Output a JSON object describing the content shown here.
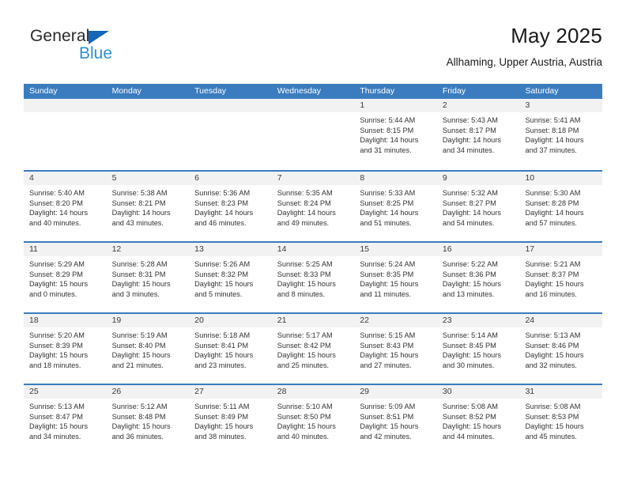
{
  "logo": {
    "primary_text": "General",
    "secondary_text": "Blue",
    "triangle_icon": "triangle-icon",
    "primary_color": "#2b2b2b",
    "secondary_color": "#2a8fd8",
    "triangle_color": "#1565b8"
  },
  "header": {
    "title": "May 2025",
    "subtitle": "Allhaming, Upper Austria, Austria"
  },
  "theme": {
    "header_bg": "#3a7cbf",
    "header_text": "#ffffff",
    "daynum_band_bg": "#f2f2f2",
    "cell_bg": "#ffffff",
    "body_text": "#333333"
  },
  "calendar": {
    "weekdays": [
      "Sunday",
      "Monday",
      "Tuesday",
      "Wednesday",
      "Thursday",
      "Friday",
      "Saturday"
    ],
    "weeks": [
      [
        {
          "day": "",
          "empty": true,
          "sunrise": "",
          "sunset": "",
          "daylight_line1": "",
          "daylight_line2": ""
        },
        {
          "day": "",
          "empty": true,
          "sunrise": "",
          "sunset": "",
          "daylight_line1": "",
          "daylight_line2": ""
        },
        {
          "day": "",
          "empty": true,
          "sunrise": "",
          "sunset": "",
          "daylight_line1": "",
          "daylight_line2": ""
        },
        {
          "day": "",
          "empty": true,
          "sunrise": "",
          "sunset": "",
          "daylight_line1": "",
          "daylight_line2": ""
        },
        {
          "day": "1",
          "empty": false,
          "sunrise": "Sunrise: 5:44 AM",
          "sunset": "Sunset: 8:15 PM",
          "daylight_line1": "Daylight: 14 hours",
          "daylight_line2": "and 31 minutes."
        },
        {
          "day": "2",
          "empty": false,
          "sunrise": "Sunrise: 5:43 AM",
          "sunset": "Sunset: 8:17 PM",
          "daylight_line1": "Daylight: 14 hours",
          "daylight_line2": "and 34 minutes."
        },
        {
          "day": "3",
          "empty": false,
          "sunrise": "Sunrise: 5:41 AM",
          "sunset": "Sunset: 8:18 PM",
          "daylight_line1": "Daylight: 14 hours",
          "daylight_line2": "and 37 minutes."
        }
      ],
      [
        {
          "day": "4",
          "empty": false,
          "sunrise": "Sunrise: 5:40 AM",
          "sunset": "Sunset: 8:20 PM",
          "daylight_line1": "Daylight: 14 hours",
          "daylight_line2": "and 40 minutes."
        },
        {
          "day": "5",
          "empty": false,
          "sunrise": "Sunrise: 5:38 AM",
          "sunset": "Sunset: 8:21 PM",
          "daylight_line1": "Daylight: 14 hours",
          "daylight_line2": "and 43 minutes."
        },
        {
          "day": "6",
          "empty": false,
          "sunrise": "Sunrise: 5:36 AM",
          "sunset": "Sunset: 8:23 PM",
          "daylight_line1": "Daylight: 14 hours",
          "daylight_line2": "and 46 minutes."
        },
        {
          "day": "7",
          "empty": false,
          "sunrise": "Sunrise: 5:35 AM",
          "sunset": "Sunset: 8:24 PM",
          "daylight_line1": "Daylight: 14 hours",
          "daylight_line2": "and 49 minutes."
        },
        {
          "day": "8",
          "empty": false,
          "sunrise": "Sunrise: 5:33 AM",
          "sunset": "Sunset: 8:25 PM",
          "daylight_line1": "Daylight: 14 hours",
          "daylight_line2": "and 51 minutes."
        },
        {
          "day": "9",
          "empty": false,
          "sunrise": "Sunrise: 5:32 AM",
          "sunset": "Sunset: 8:27 PM",
          "daylight_line1": "Daylight: 14 hours",
          "daylight_line2": "and 54 minutes."
        },
        {
          "day": "10",
          "empty": false,
          "sunrise": "Sunrise: 5:30 AM",
          "sunset": "Sunset: 8:28 PM",
          "daylight_line1": "Daylight: 14 hours",
          "daylight_line2": "and 57 minutes."
        }
      ],
      [
        {
          "day": "11",
          "empty": false,
          "sunrise": "Sunrise: 5:29 AM",
          "sunset": "Sunset: 8:29 PM",
          "daylight_line1": "Daylight: 15 hours",
          "daylight_line2": "and 0 minutes."
        },
        {
          "day": "12",
          "empty": false,
          "sunrise": "Sunrise: 5:28 AM",
          "sunset": "Sunset: 8:31 PM",
          "daylight_line1": "Daylight: 15 hours",
          "daylight_line2": "and 3 minutes."
        },
        {
          "day": "13",
          "empty": false,
          "sunrise": "Sunrise: 5:26 AM",
          "sunset": "Sunset: 8:32 PM",
          "daylight_line1": "Daylight: 15 hours",
          "daylight_line2": "and 5 minutes."
        },
        {
          "day": "14",
          "empty": false,
          "sunrise": "Sunrise: 5:25 AM",
          "sunset": "Sunset: 8:33 PM",
          "daylight_line1": "Daylight: 15 hours",
          "daylight_line2": "and 8 minutes."
        },
        {
          "day": "15",
          "empty": false,
          "sunrise": "Sunrise: 5:24 AM",
          "sunset": "Sunset: 8:35 PM",
          "daylight_line1": "Daylight: 15 hours",
          "daylight_line2": "and 11 minutes."
        },
        {
          "day": "16",
          "empty": false,
          "sunrise": "Sunrise: 5:22 AM",
          "sunset": "Sunset: 8:36 PM",
          "daylight_line1": "Daylight: 15 hours",
          "daylight_line2": "and 13 minutes."
        },
        {
          "day": "17",
          "empty": false,
          "sunrise": "Sunrise: 5:21 AM",
          "sunset": "Sunset: 8:37 PM",
          "daylight_line1": "Daylight: 15 hours",
          "daylight_line2": "and 16 minutes."
        }
      ],
      [
        {
          "day": "18",
          "empty": false,
          "sunrise": "Sunrise: 5:20 AM",
          "sunset": "Sunset: 8:39 PM",
          "daylight_line1": "Daylight: 15 hours",
          "daylight_line2": "and 18 minutes."
        },
        {
          "day": "19",
          "empty": false,
          "sunrise": "Sunrise: 5:19 AM",
          "sunset": "Sunset: 8:40 PM",
          "daylight_line1": "Daylight: 15 hours",
          "daylight_line2": "and 21 minutes."
        },
        {
          "day": "20",
          "empty": false,
          "sunrise": "Sunrise: 5:18 AM",
          "sunset": "Sunset: 8:41 PM",
          "daylight_line1": "Daylight: 15 hours",
          "daylight_line2": "and 23 minutes."
        },
        {
          "day": "21",
          "empty": false,
          "sunrise": "Sunrise: 5:17 AM",
          "sunset": "Sunset: 8:42 PM",
          "daylight_line1": "Daylight: 15 hours",
          "daylight_line2": "and 25 minutes."
        },
        {
          "day": "22",
          "empty": false,
          "sunrise": "Sunrise: 5:15 AM",
          "sunset": "Sunset: 8:43 PM",
          "daylight_line1": "Daylight: 15 hours",
          "daylight_line2": "and 27 minutes."
        },
        {
          "day": "23",
          "empty": false,
          "sunrise": "Sunrise: 5:14 AM",
          "sunset": "Sunset: 8:45 PM",
          "daylight_line1": "Daylight: 15 hours",
          "daylight_line2": "and 30 minutes."
        },
        {
          "day": "24",
          "empty": false,
          "sunrise": "Sunrise: 5:13 AM",
          "sunset": "Sunset: 8:46 PM",
          "daylight_line1": "Daylight: 15 hours",
          "daylight_line2": "and 32 minutes."
        }
      ],
      [
        {
          "day": "25",
          "empty": false,
          "sunrise": "Sunrise: 5:13 AM",
          "sunset": "Sunset: 8:47 PM",
          "daylight_line1": "Daylight: 15 hours",
          "daylight_line2": "and 34 minutes."
        },
        {
          "day": "26",
          "empty": false,
          "sunrise": "Sunrise: 5:12 AM",
          "sunset": "Sunset: 8:48 PM",
          "daylight_line1": "Daylight: 15 hours",
          "daylight_line2": "and 36 minutes."
        },
        {
          "day": "27",
          "empty": false,
          "sunrise": "Sunrise: 5:11 AM",
          "sunset": "Sunset: 8:49 PM",
          "daylight_line1": "Daylight: 15 hours",
          "daylight_line2": "and 38 minutes."
        },
        {
          "day": "28",
          "empty": false,
          "sunrise": "Sunrise: 5:10 AM",
          "sunset": "Sunset: 8:50 PM",
          "daylight_line1": "Daylight: 15 hours",
          "daylight_line2": "and 40 minutes."
        },
        {
          "day": "29",
          "empty": false,
          "sunrise": "Sunrise: 5:09 AM",
          "sunset": "Sunset: 8:51 PM",
          "daylight_line1": "Daylight: 15 hours",
          "daylight_line2": "and 42 minutes."
        },
        {
          "day": "30",
          "empty": false,
          "sunrise": "Sunrise: 5:08 AM",
          "sunset": "Sunset: 8:52 PM",
          "daylight_line1": "Daylight: 15 hours",
          "daylight_line2": "and 44 minutes."
        },
        {
          "day": "31",
          "empty": false,
          "sunrise": "Sunrise: 5:08 AM",
          "sunset": "Sunset: 8:53 PM",
          "daylight_line1": "Daylight: 15 hours",
          "daylight_line2": "and 45 minutes."
        }
      ]
    ]
  }
}
